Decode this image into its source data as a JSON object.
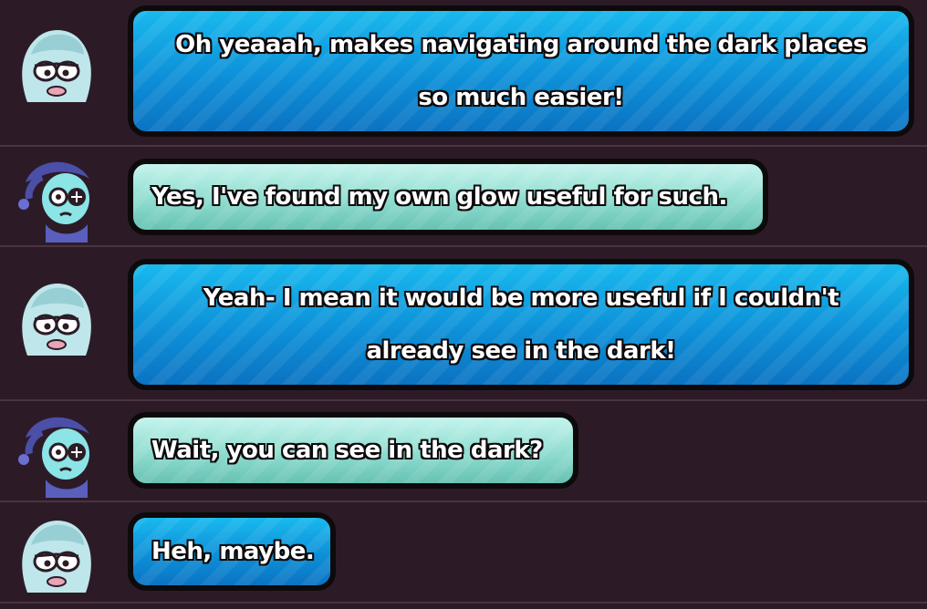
{
  "messages": [
    {
      "speaker": "ghost",
      "style": "blue",
      "lines": [
        "Oh yeaaah, makes navigating around the dark places",
        "so much easier!"
      ]
    },
    {
      "speaker": "nightcap",
      "style": "teal",
      "lines": [
        "Yes, I've found my own glow useful for such."
      ]
    },
    {
      "speaker": "ghost",
      "style": "blue",
      "lines": [
        "Yeah- I mean it would be more useful if I couldn't",
        "already see in the dark!"
      ]
    },
    {
      "speaker": "nightcap",
      "style": "teal",
      "lines": [
        "Wait, you can see in the dark?"
      ]
    },
    {
      "speaker": "ghost",
      "style": "blue",
      "lines": [
        "Heh, maybe."
      ]
    }
  ],
  "icons": {
    "ghost": "ghost-girl-avatar-icon",
    "nightcap": "nightcap-creature-avatar-icon"
  },
  "colors": {
    "background": "#2c1b27",
    "divider": "#4a3441",
    "bubble_blue": "#0d90d8",
    "bubble_teal": "#8fdccf",
    "outline": "#0d0a0c"
  }
}
